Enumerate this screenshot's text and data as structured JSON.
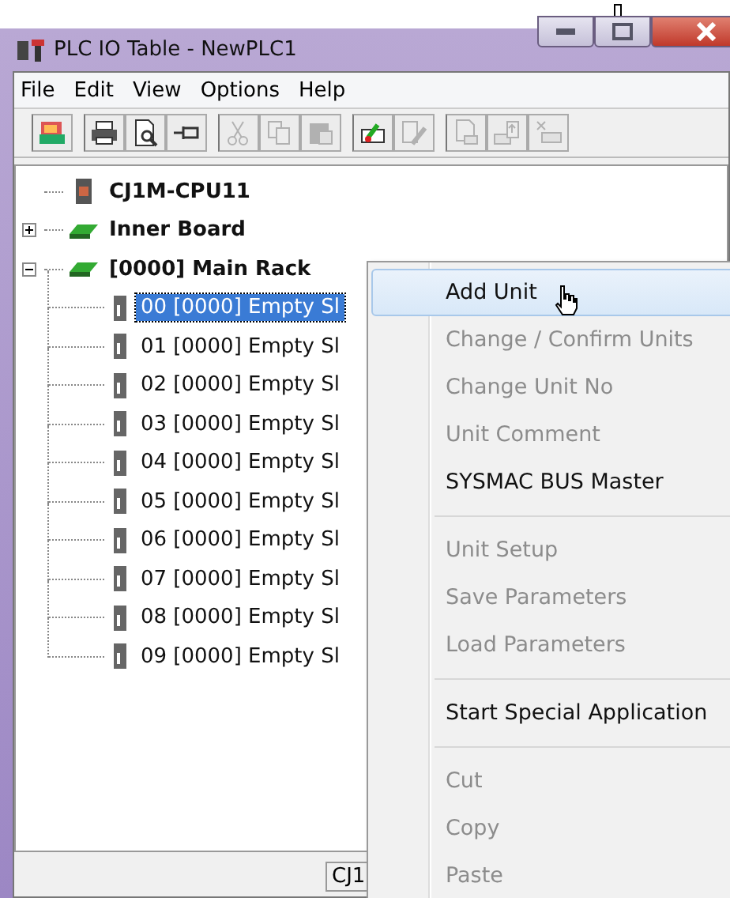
{
  "window": {
    "title": "PLC IO Table - NewPLC1"
  },
  "menu_bar": [
    "File",
    "Edit",
    "View",
    "Options",
    "Help"
  ],
  "toolbar": [
    {
      "kind": "cps",
      "disabled": false,
      "group_start": true
    },
    {
      "kind": "print",
      "disabled": false,
      "group_start": true
    },
    {
      "kind": "preview",
      "disabled": false,
      "group_start": false
    },
    {
      "kind": "pin",
      "disabled": false,
      "group_start": false
    },
    {
      "kind": "cut",
      "disabled": true,
      "group_start": true
    },
    {
      "kind": "copy",
      "disabled": true,
      "group_start": false
    },
    {
      "kind": "paste",
      "disabled": true,
      "group_start": false
    },
    {
      "kind": "transfer",
      "disabled": false,
      "group_start": true
    },
    {
      "kind": "edit",
      "disabled": true,
      "group_start": false
    },
    {
      "kind": "doc",
      "disabled": true,
      "group_start": true
    },
    {
      "kind": "upload",
      "disabled": true,
      "group_start": false
    },
    {
      "kind": "swap",
      "disabled": true,
      "group_start": false
    }
  ],
  "tree": [
    {
      "label": "CJ1M-CPU11",
      "kind": "cpu",
      "selected": false
    },
    {
      "label": "Inner Board",
      "kind": "rack",
      "expanded": false,
      "selected": false
    },
    {
      "label": "[0000] Main Rack",
      "kind": "rack",
      "expanded": true,
      "selected": false,
      "children": [
        {
          "label": "00 [0000] Empty Sl",
          "kind": "slot",
          "selected": true
        },
        {
          "label": "01 [0000] Empty Sl",
          "kind": "slot",
          "selected": false
        },
        {
          "label": "02 [0000] Empty Sl",
          "kind": "slot",
          "selected": false
        },
        {
          "label": "03 [0000] Empty Sl",
          "kind": "slot",
          "selected": false
        },
        {
          "label": "04 [0000] Empty Sl",
          "kind": "slot",
          "selected": false
        },
        {
          "label": "05 [0000] Empty Sl",
          "kind": "slot",
          "selected": false
        },
        {
          "label": "06 [0000] Empty Sl",
          "kind": "slot",
          "selected": false
        },
        {
          "label": "07 [0000] Empty Sl",
          "kind": "slot",
          "selected": false
        },
        {
          "label": "08 [0000] Empty Sl",
          "kind": "slot",
          "selected": false
        },
        {
          "label": "09 [0000] Empty Sl",
          "kind": "slot",
          "selected": false
        }
      ]
    }
  ],
  "context_menu": [
    {
      "kind": "item",
      "label": "Add Unit",
      "disabled": false,
      "selected": true
    },
    {
      "kind": "item",
      "label": "Change / Confirm Units",
      "disabled": true,
      "selected": false
    },
    {
      "kind": "item",
      "label": "Change Unit No",
      "disabled": true,
      "selected": false
    },
    {
      "kind": "item",
      "label": "Unit Comment",
      "disabled": true,
      "selected": false
    },
    {
      "kind": "item",
      "label": "SYSMAC BUS Master",
      "disabled": false,
      "selected": false
    },
    {
      "kind": "separator"
    },
    {
      "kind": "item",
      "label": "Unit Setup",
      "disabled": true,
      "selected": false
    },
    {
      "kind": "item",
      "label": "Save Parameters",
      "disabled": true,
      "selected": false
    },
    {
      "kind": "item",
      "label": "Load Parameters",
      "disabled": true,
      "selected": false
    },
    {
      "kind": "separator"
    },
    {
      "kind": "item",
      "label": "Start Special Application",
      "disabled": false,
      "selected": false
    },
    {
      "kind": "separator"
    },
    {
      "kind": "item",
      "label": "Cut",
      "disabled": true,
      "selected": false
    },
    {
      "kind": "item",
      "label": "Copy",
      "disabled": true,
      "selected": false
    },
    {
      "kind": "item",
      "label": "Paste",
      "disabled": true,
      "selected": false
    }
  ],
  "status_bar": {
    "text": "CJ1"
  }
}
